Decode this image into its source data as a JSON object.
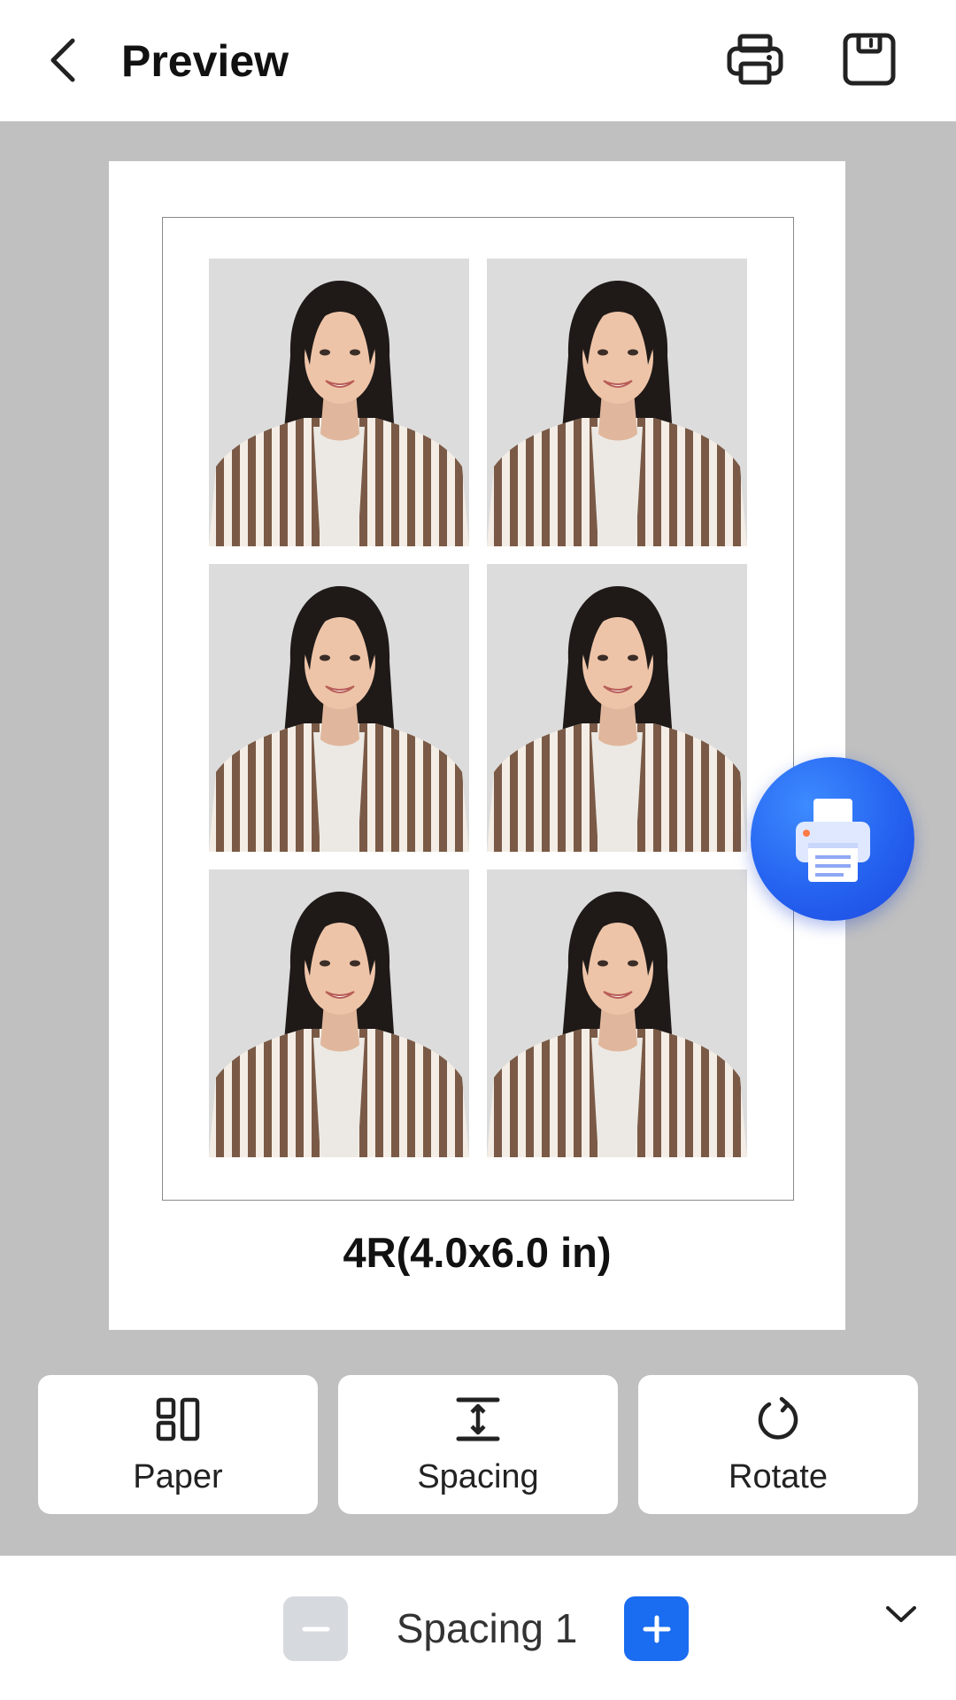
{
  "header": {
    "title": "Preview",
    "back_icon": "chevron-left-icon",
    "print_icon": "printer-icon",
    "save_icon": "save-icon"
  },
  "preview": {
    "paper_size_label": "4R(4.0x6.0 in)",
    "photos": [
      {
        "name": "id-photo-1"
      },
      {
        "name": "id-photo-2"
      },
      {
        "name": "id-photo-3"
      },
      {
        "name": "id-photo-4"
      },
      {
        "name": "id-photo-5"
      },
      {
        "name": "id-photo-6"
      }
    ],
    "fab_icon": "printer-icon",
    "accent_color": "#1a6cf0"
  },
  "toolbar": {
    "items": [
      {
        "label": "Paper",
        "icon": "layout-grid-icon"
      },
      {
        "label": "Spacing",
        "icon": "vertical-spacing-icon"
      },
      {
        "label": "Rotate",
        "icon": "rotate-icon"
      }
    ]
  },
  "spacing_control": {
    "value_label": "Spacing 1",
    "minus_icon": "minus-icon",
    "plus_icon": "plus-icon",
    "collapse_icon": "chevron-down-icon"
  }
}
